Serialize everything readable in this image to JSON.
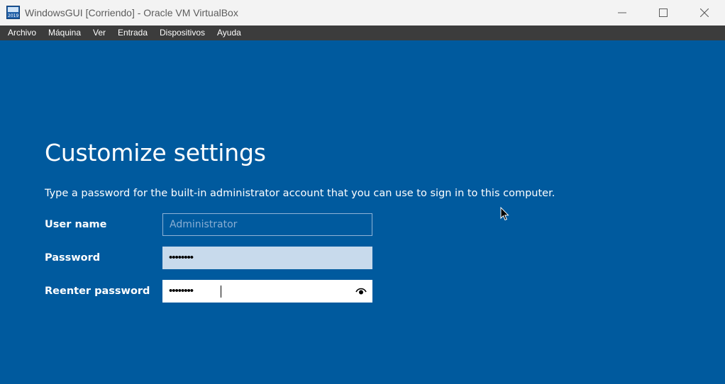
{
  "window": {
    "title": "WindowsGUI [Corriendo] - Oracle VM VirtualBox",
    "icon_text": "2019"
  },
  "menubar": {
    "items": [
      "Archivo",
      "Máquina",
      "Ver",
      "Entrada",
      "Dispositivos",
      "Ayuda"
    ]
  },
  "setup": {
    "heading": "Customize settings",
    "description": "Type a password for the built-in administrator account that you can use to sign in to this computer.",
    "username_label": "User name",
    "username_placeholder": "Administrator",
    "password_label": "Password",
    "password_value": "••••••••",
    "reenter_label": "Reenter password",
    "reenter_value": "••••••••"
  },
  "colors": {
    "background": "#005a9e",
    "menubar": "#3c3c3c",
    "titlebar": "#f3f3f3"
  },
  "icons": {
    "minimize": "minimize-icon",
    "maximize": "maximize-icon",
    "close": "close-icon",
    "reveal": "eye-icon"
  }
}
